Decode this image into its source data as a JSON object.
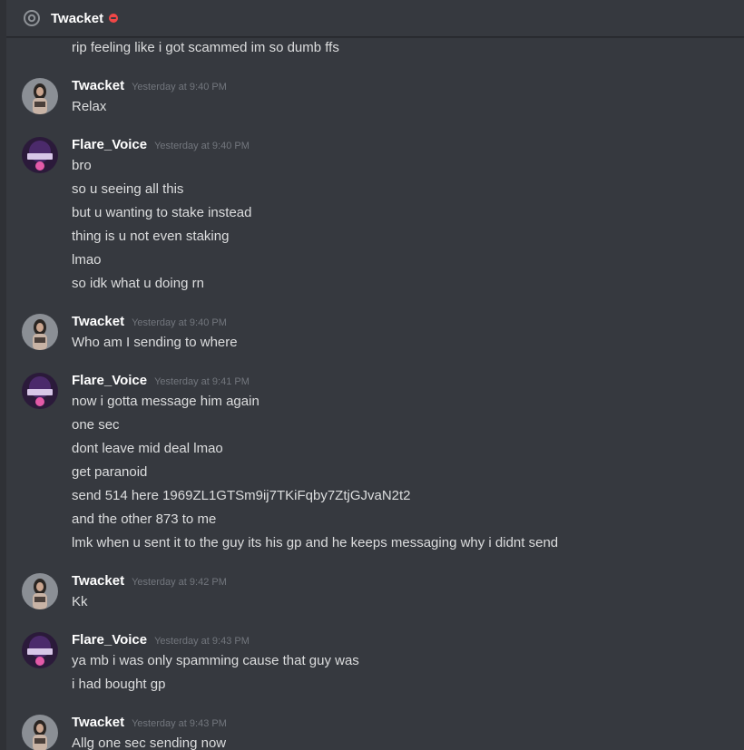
{
  "header": {
    "channel_name": "Twacket"
  },
  "colors": {
    "background": "#36393f",
    "status_dnd": "#f04747",
    "author": "#ffffff",
    "timestamp": "#72767d"
  },
  "messages": {
    "m0": {
      "lines": [
        "rip feeling like i got scammed im so dumb ffs"
      ]
    },
    "g1": {
      "author": "Twacket",
      "time": "Yesterday at 9:40 PM",
      "lines": [
        "Relax"
      ]
    },
    "g2": {
      "author": "Flare_Voice",
      "time": "Yesterday at 9:40 PM",
      "lines": [
        "bro",
        "so u seeing all this",
        "but u wanting to stake instead",
        "thing is u not even staking",
        "lmao",
        "so idk what u doing rn"
      ]
    },
    "g3": {
      "author": "Twacket",
      "time": "Yesterday at 9:40 PM",
      "lines": [
        "Who am I sending to where"
      ]
    },
    "g4": {
      "author": "Flare_Voice",
      "time": "Yesterday at 9:41 PM",
      "lines": [
        "now i gotta message him again",
        "one sec",
        "dont leave mid deal lmao",
        "get paranoid",
        "send 514 here 1969ZL1GTSm9ij7TKiFqby7ZtjGJvaN2t2",
        "and the other 873 to me",
        "lmk when u sent it to the guy its his gp and he keeps messaging why i didnt send"
      ]
    },
    "g5": {
      "author": "Twacket",
      "time": "Yesterday at 9:42 PM",
      "lines": [
        "Kk"
      ]
    },
    "g6": {
      "author": "Flare_Voice",
      "time": "Yesterday at 9:43 PM",
      "lines": [
        "ya mb i was only spamming cause that guy was",
        "i had bought gp"
      ]
    },
    "g7": {
      "author": "Twacket",
      "time": "Yesterday at 9:43 PM",
      "lines": [
        "Allg one sec sending now"
      ]
    }
  }
}
